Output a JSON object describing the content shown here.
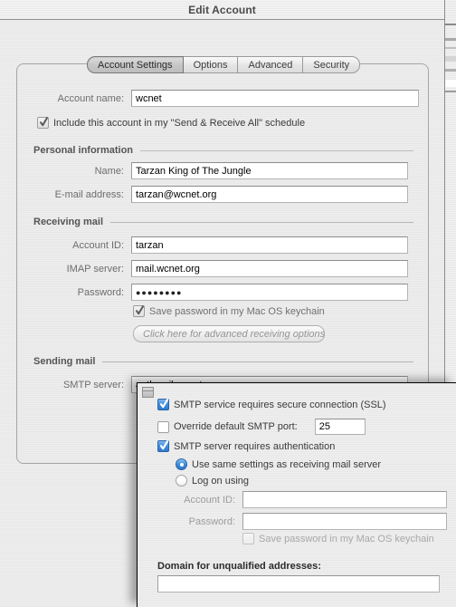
{
  "window": {
    "title": "Edit Account"
  },
  "tabs": [
    {
      "label": "Account Settings",
      "selected": true
    },
    {
      "label": "Options",
      "selected": false
    },
    {
      "label": "Advanced",
      "selected": false
    },
    {
      "label": "Security",
      "selected": false
    }
  ],
  "account": {
    "name_label": "Account name:",
    "name_value": "wcnet",
    "include_schedule_label": "Include this account in my \"Send & Receive All\" schedule",
    "include_schedule_checked": true
  },
  "personal": {
    "section_title": "Personal information",
    "name_label": "Name:",
    "name_value": "Tarzan King of The Jungle",
    "email_label": "E-mail address:",
    "email_value": "tarzan@wcnet.org"
  },
  "receiving": {
    "section_title": "Receiving mail",
    "account_id_label": "Account ID:",
    "account_id_value": "tarzan",
    "imap_label": "IMAP server:",
    "imap_value": "mail.wcnet.org",
    "password_label": "Password:",
    "password_value": "●●●●●●●●",
    "keychain_label": "Save password in my Mac OS keychain",
    "keychain_checked": true,
    "advanced_button_label": "Click here for advanced receiving options"
  },
  "sending": {
    "section_title": "Sending mail",
    "smtp_label": "SMTP server:",
    "smtp_value": "authmail.wcnet.org"
  },
  "smtp_sheet": {
    "grip_icon": "collapse-widget-icon",
    "ssl_label": "SMTP service requires secure connection (SSL)",
    "ssl_checked": true,
    "override_port_label": "Override default SMTP port:",
    "override_port_checked": false,
    "port_value": "25",
    "requires_auth_label": "SMTP server requires authentication",
    "requires_auth_checked": true,
    "radio_same_settings_label": "Use same settings as receiving mail server",
    "radio_same_settings_selected": true,
    "radio_log_on_label": "Log on using",
    "radio_log_on_selected": false,
    "account_id_label": "Account ID:",
    "account_id_value": "",
    "password_label": "Password:",
    "password_value": "",
    "keychain_label": "Save password in my Mac OS keychain",
    "keychain_checked": false,
    "domain_label": "Domain for unqualified addresses:",
    "domain_value": ""
  },
  "colors": {
    "accent_blue": "#3e8ddd",
    "window_bg": "#ebebeb",
    "label_gray": "#6d6d6d"
  }
}
